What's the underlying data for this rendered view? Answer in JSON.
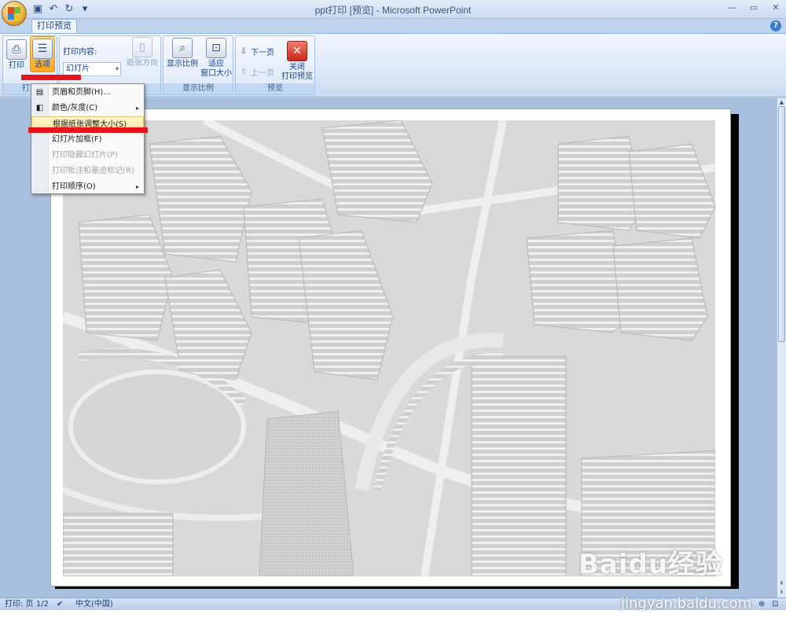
{
  "window": {
    "title": "ppt打印 [预览] - Microsoft PowerPoint",
    "controls": [
      "minimize",
      "restore",
      "close"
    ]
  },
  "quick_access": [
    "save-icon",
    "undo-icon",
    "redo-icon",
    "customize-icon"
  ],
  "tabs": {
    "active": "打印预览"
  },
  "ribbon": {
    "print": {
      "print_label": "打印",
      "options_label": "选项",
      "group_label": "打印"
    },
    "content": {
      "label": "打印内容:",
      "value": "幻灯片",
      "orientation_label": "纸张方向"
    },
    "zoom": {
      "zoom_label": "显示比例",
      "fit_label_1": "适应",
      "fit_label_2": "窗口大小",
      "group_label": "显示比例"
    },
    "preview": {
      "next_label": "下一页",
      "prev_label": "上一页",
      "close_label_1": "关闭",
      "close_label_2": "打印预览",
      "group_label": "预览"
    }
  },
  "menu": {
    "items": [
      {
        "label": "页眉和页脚(H)...",
        "enabled": true
      },
      {
        "label": "颜色/灰度(C)",
        "enabled": true,
        "submenu": true
      },
      {
        "label": "根据纸张调整大小(S)",
        "enabled": true,
        "highlighted": true
      },
      {
        "label": "幻灯片加框(F)",
        "enabled": true
      },
      {
        "label": "打印隐藏幻灯片(P)",
        "enabled": false
      },
      {
        "label": "打印批注和墨迹标记(R)",
        "enabled": false
      },
      {
        "label": "打印顺序(O)",
        "enabled": true,
        "submenu": true
      }
    ]
  },
  "status": {
    "page": "打印: 页 1/2",
    "language": "中文(中国)"
  },
  "watermark": {
    "brand": "Baidu经验",
    "url": "jingyan.baidu.com"
  },
  "colors": {
    "accent": "#15428b",
    "highlight_red": "#e8141c",
    "active_button": "#ffc04a"
  }
}
